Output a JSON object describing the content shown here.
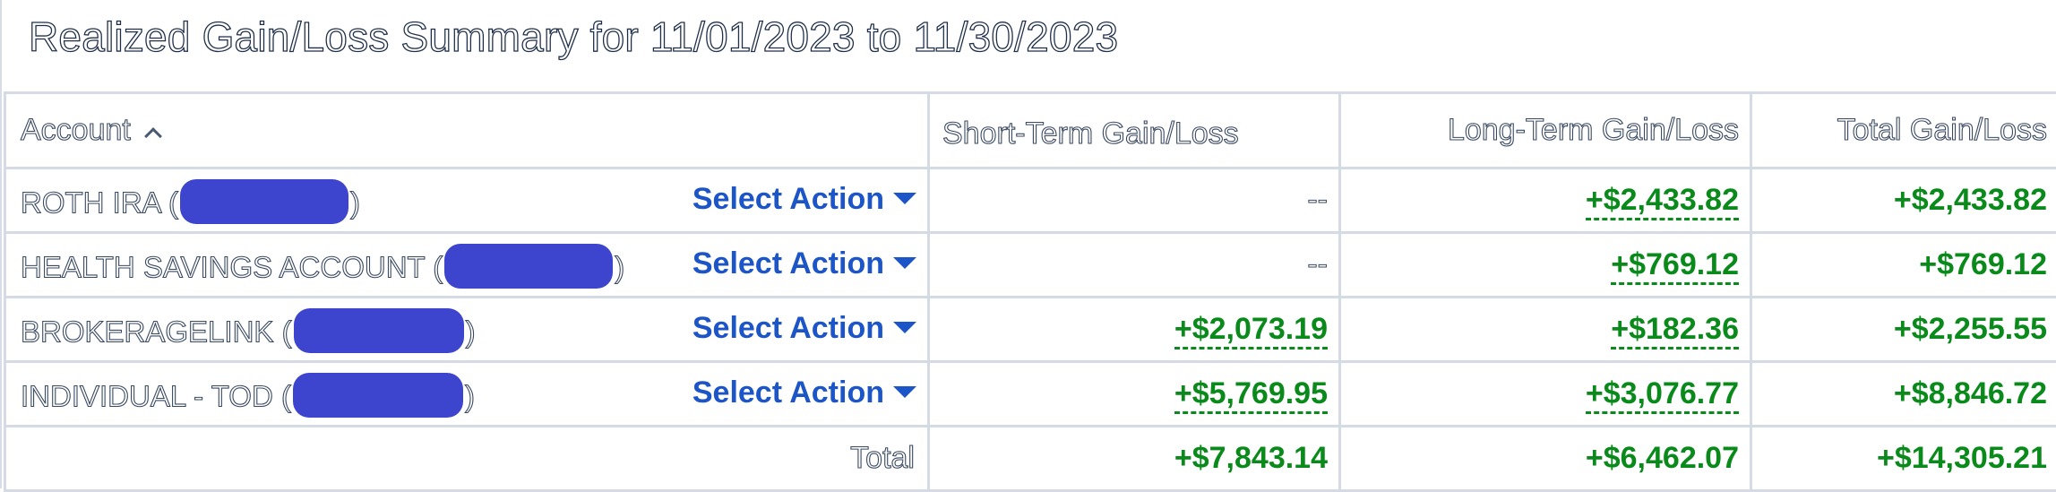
{
  "title": "Realized Gain/Loss Summary for 11/01/2023 to 11/30/2023",
  "columns": {
    "account": "Account",
    "short_term": "Short-Term Gain/Loss",
    "long_term": "Long-Term Gain/Loss",
    "total": "Total Gain/Loss"
  },
  "select_action_label": "Select Action",
  "rows": [
    {
      "account": "ROTH IRA (",
      "close": ")",
      "short_term": "--",
      "long_term": "+$2,433.82",
      "total": "+$2,433.82"
    },
    {
      "account": "HEALTH SAVINGS ACCOUNT (",
      "close": ")",
      "short_term": "--",
      "long_term": "+$769.12",
      "total": "+$769.12"
    },
    {
      "account": "BROKERAGELINK (",
      "close": ")",
      "short_term": "+$2,073.19",
      "long_term": "+$182.36",
      "total": "+$2,255.55"
    },
    {
      "account": "INDIVIDUAL - TOD (",
      "close": ")",
      "short_term": "+$5,769.95",
      "long_term": "+$3,076.77",
      "total": "+$8,846.72"
    }
  ],
  "totals": {
    "label": "Total",
    "short_term": "+$7,843.14",
    "long_term": "+$6,462.07",
    "total": "+$14,305.21"
  },
  "colors": {
    "gain": "#0b8a1c",
    "action": "#1c55c8",
    "redaction": "#3d45cf",
    "border": "#d5dbe5"
  },
  "icons": {
    "sort": "chevron-up-icon",
    "action": "caret-down-icon"
  }
}
